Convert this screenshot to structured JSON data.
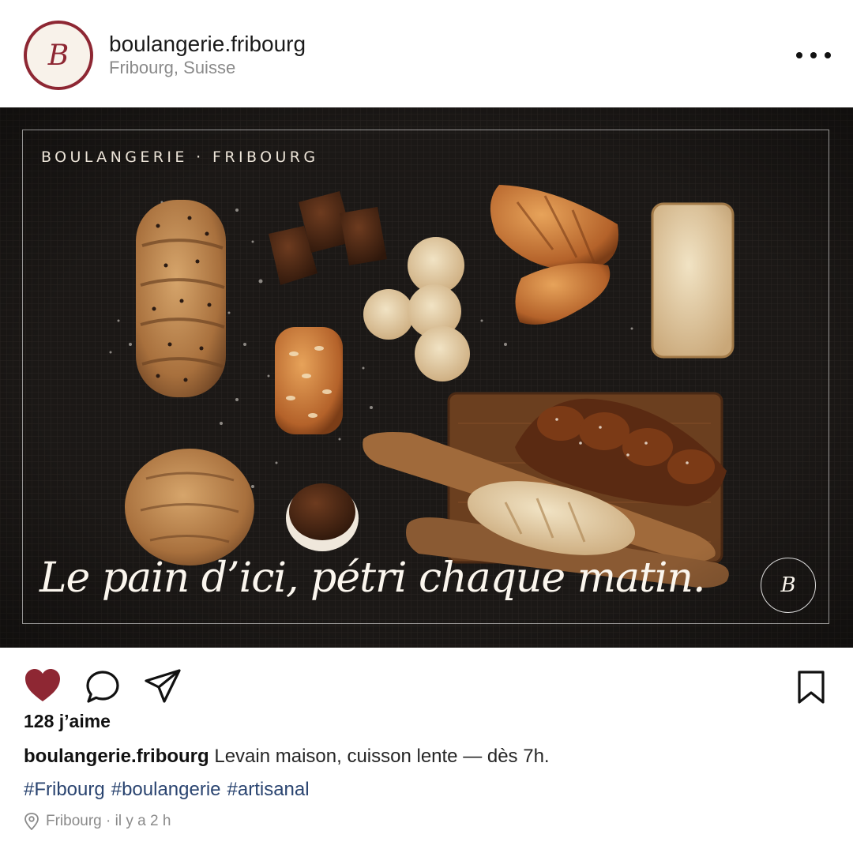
{
  "header": {
    "avatar_letter": "B",
    "username": "boulangerie.fribourg",
    "location": "Fribourg, Suisse"
  },
  "post": {
    "kicker": "BOULANGERIE · FRIBOURG",
    "tagline": "Le pain d’ici, pétri chaque matin.",
    "badge_letter": "B"
  },
  "actions": {
    "liked": true,
    "like_color": "#8e2733"
  },
  "likes": "128 j’aime",
  "caption": {
    "username": "boulangerie.fribourg",
    "text": "Levain maison, cuisson lente — dès 7h."
  },
  "hashtags": [
    "#Fribourg",
    "#boulangerie",
    "#artisanal"
  ],
  "meta": {
    "location": "Fribourg",
    "separator": " · ",
    "time": "il y a 2 h"
  },
  "colors": {
    "brand": "#8e2733",
    "hashtag": "#2a4470",
    "muted": "#8a8a8a"
  }
}
